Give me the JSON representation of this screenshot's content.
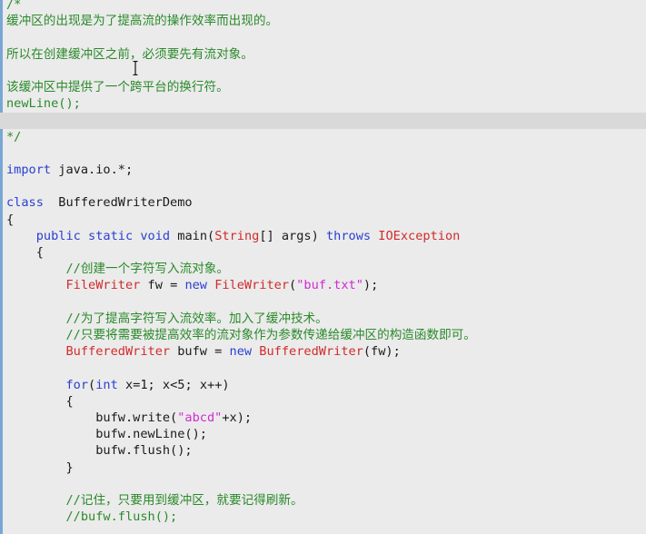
{
  "editor": {
    "colors": {
      "background": "#ebebeb",
      "current_line": "#d9d9d9",
      "comment": "#2b8a2b",
      "keyword": "#2a3fd1",
      "type": "#d12b2b",
      "string": "#d12bd1",
      "text": "#1a1a1a",
      "gutter": "#7aa6d6"
    },
    "lines": [
      {
        "segments": [
          {
            "t": "/*",
            "c": "comment"
          }
        ]
      },
      {
        "segments": [
          {
            "t": "缓冲区的出现是为了提高流的操作效率而出现的。",
            "c": "comment"
          }
        ]
      },
      {
        "segments": []
      },
      {
        "segments": [
          {
            "t": "所以在创建缓冲区之前，必须要先有流对象。",
            "c": "comment"
          }
        ]
      },
      {
        "segments": []
      },
      {
        "segments": [
          {
            "t": "该缓冲区中提供了一个跨平台的换行符。",
            "c": "comment"
          }
        ]
      },
      {
        "segments": [
          {
            "t": "newLine();",
            "c": "comment"
          }
        ]
      },
      {
        "segments": []
      },
      {
        "segments": [
          {
            "t": "*/",
            "c": "comment"
          }
        ]
      },
      {
        "segments": []
      },
      {
        "segments": [
          {
            "t": "import",
            "c": "kw"
          },
          {
            "t": " java.io.*;",
            "c": "plain"
          }
        ]
      },
      {
        "segments": []
      },
      {
        "segments": [
          {
            "t": "class",
            "c": "kw"
          },
          {
            "t": "  BufferedWriterDemo",
            "c": "plain"
          }
        ]
      },
      {
        "segments": [
          {
            "t": "{",
            "c": "plain"
          }
        ]
      },
      {
        "segments": [
          {
            "t": "    ",
            "c": "plain"
          },
          {
            "t": "public",
            "c": "kw"
          },
          {
            "t": " ",
            "c": "plain"
          },
          {
            "t": "static",
            "c": "kw"
          },
          {
            "t": " ",
            "c": "plain"
          },
          {
            "t": "void",
            "c": "kw"
          },
          {
            "t": " main(",
            "c": "plain"
          },
          {
            "t": "String",
            "c": "type"
          },
          {
            "t": "[] args) ",
            "c": "plain"
          },
          {
            "t": "throws",
            "c": "kw"
          },
          {
            "t": " ",
            "c": "plain"
          },
          {
            "t": "IOException",
            "c": "type"
          }
        ]
      },
      {
        "segments": [
          {
            "t": "    {",
            "c": "plain"
          }
        ]
      },
      {
        "segments": [
          {
            "t": "        ",
            "c": "plain"
          },
          {
            "t": "//创建一个字符写入流对象。",
            "c": "comment"
          }
        ]
      },
      {
        "segments": [
          {
            "t": "        ",
            "c": "plain"
          },
          {
            "t": "FileWriter",
            "c": "type"
          },
          {
            "t": " fw = ",
            "c": "plain"
          },
          {
            "t": "new",
            "c": "kw"
          },
          {
            "t": " ",
            "c": "plain"
          },
          {
            "t": "FileWriter",
            "c": "type"
          },
          {
            "t": "(",
            "c": "plain"
          },
          {
            "t": "\"buf.txt\"",
            "c": "str"
          },
          {
            "t": ");",
            "c": "plain"
          }
        ]
      },
      {
        "segments": []
      },
      {
        "segments": [
          {
            "t": "        ",
            "c": "plain"
          },
          {
            "t": "//为了提高字符写入流效率。加入了缓冲技术。",
            "c": "comment"
          }
        ]
      },
      {
        "segments": [
          {
            "t": "        ",
            "c": "plain"
          },
          {
            "t": "//只要将需要被提高效率的流对象作为参数传递给缓冲区的构造函数即可。",
            "c": "comment"
          }
        ]
      },
      {
        "segments": [
          {
            "t": "        ",
            "c": "plain"
          },
          {
            "t": "BufferedWriter",
            "c": "type"
          },
          {
            "t": " bufw = ",
            "c": "plain"
          },
          {
            "t": "new",
            "c": "kw"
          },
          {
            "t": " ",
            "c": "plain"
          },
          {
            "t": "BufferedWriter",
            "c": "type"
          },
          {
            "t": "(fw);",
            "c": "plain"
          }
        ]
      },
      {
        "segments": []
      },
      {
        "segments": [
          {
            "t": "        ",
            "c": "plain"
          },
          {
            "t": "for",
            "c": "kw"
          },
          {
            "t": "(",
            "c": "plain"
          },
          {
            "t": "int",
            "c": "kw"
          },
          {
            "t": " x=1; x<5; x++)",
            "c": "plain"
          }
        ]
      },
      {
        "segments": [
          {
            "t": "        {",
            "c": "plain"
          }
        ]
      },
      {
        "segments": [
          {
            "t": "            bufw.write(",
            "c": "plain"
          },
          {
            "t": "\"abcd\"",
            "c": "str"
          },
          {
            "t": "+x);",
            "c": "plain"
          }
        ]
      },
      {
        "segments": [
          {
            "t": "            bufw.newLine();",
            "c": "plain"
          }
        ]
      },
      {
        "segments": [
          {
            "t": "            bufw.flush();",
            "c": "plain"
          }
        ]
      },
      {
        "segments": [
          {
            "t": "        }",
            "c": "plain"
          }
        ]
      },
      {
        "segments": []
      },
      {
        "segments": [
          {
            "t": "        ",
            "c": "plain"
          },
          {
            "t": "//记住，只要用到缓冲区，就要记得刷新。",
            "c": "comment"
          }
        ]
      },
      {
        "segments": [
          {
            "t": "        ",
            "c": "plain"
          },
          {
            "t": "//bufw.flush();",
            "c": "comment"
          }
        ]
      }
    ],
    "cursor_icon": "i-beam-icon"
  }
}
